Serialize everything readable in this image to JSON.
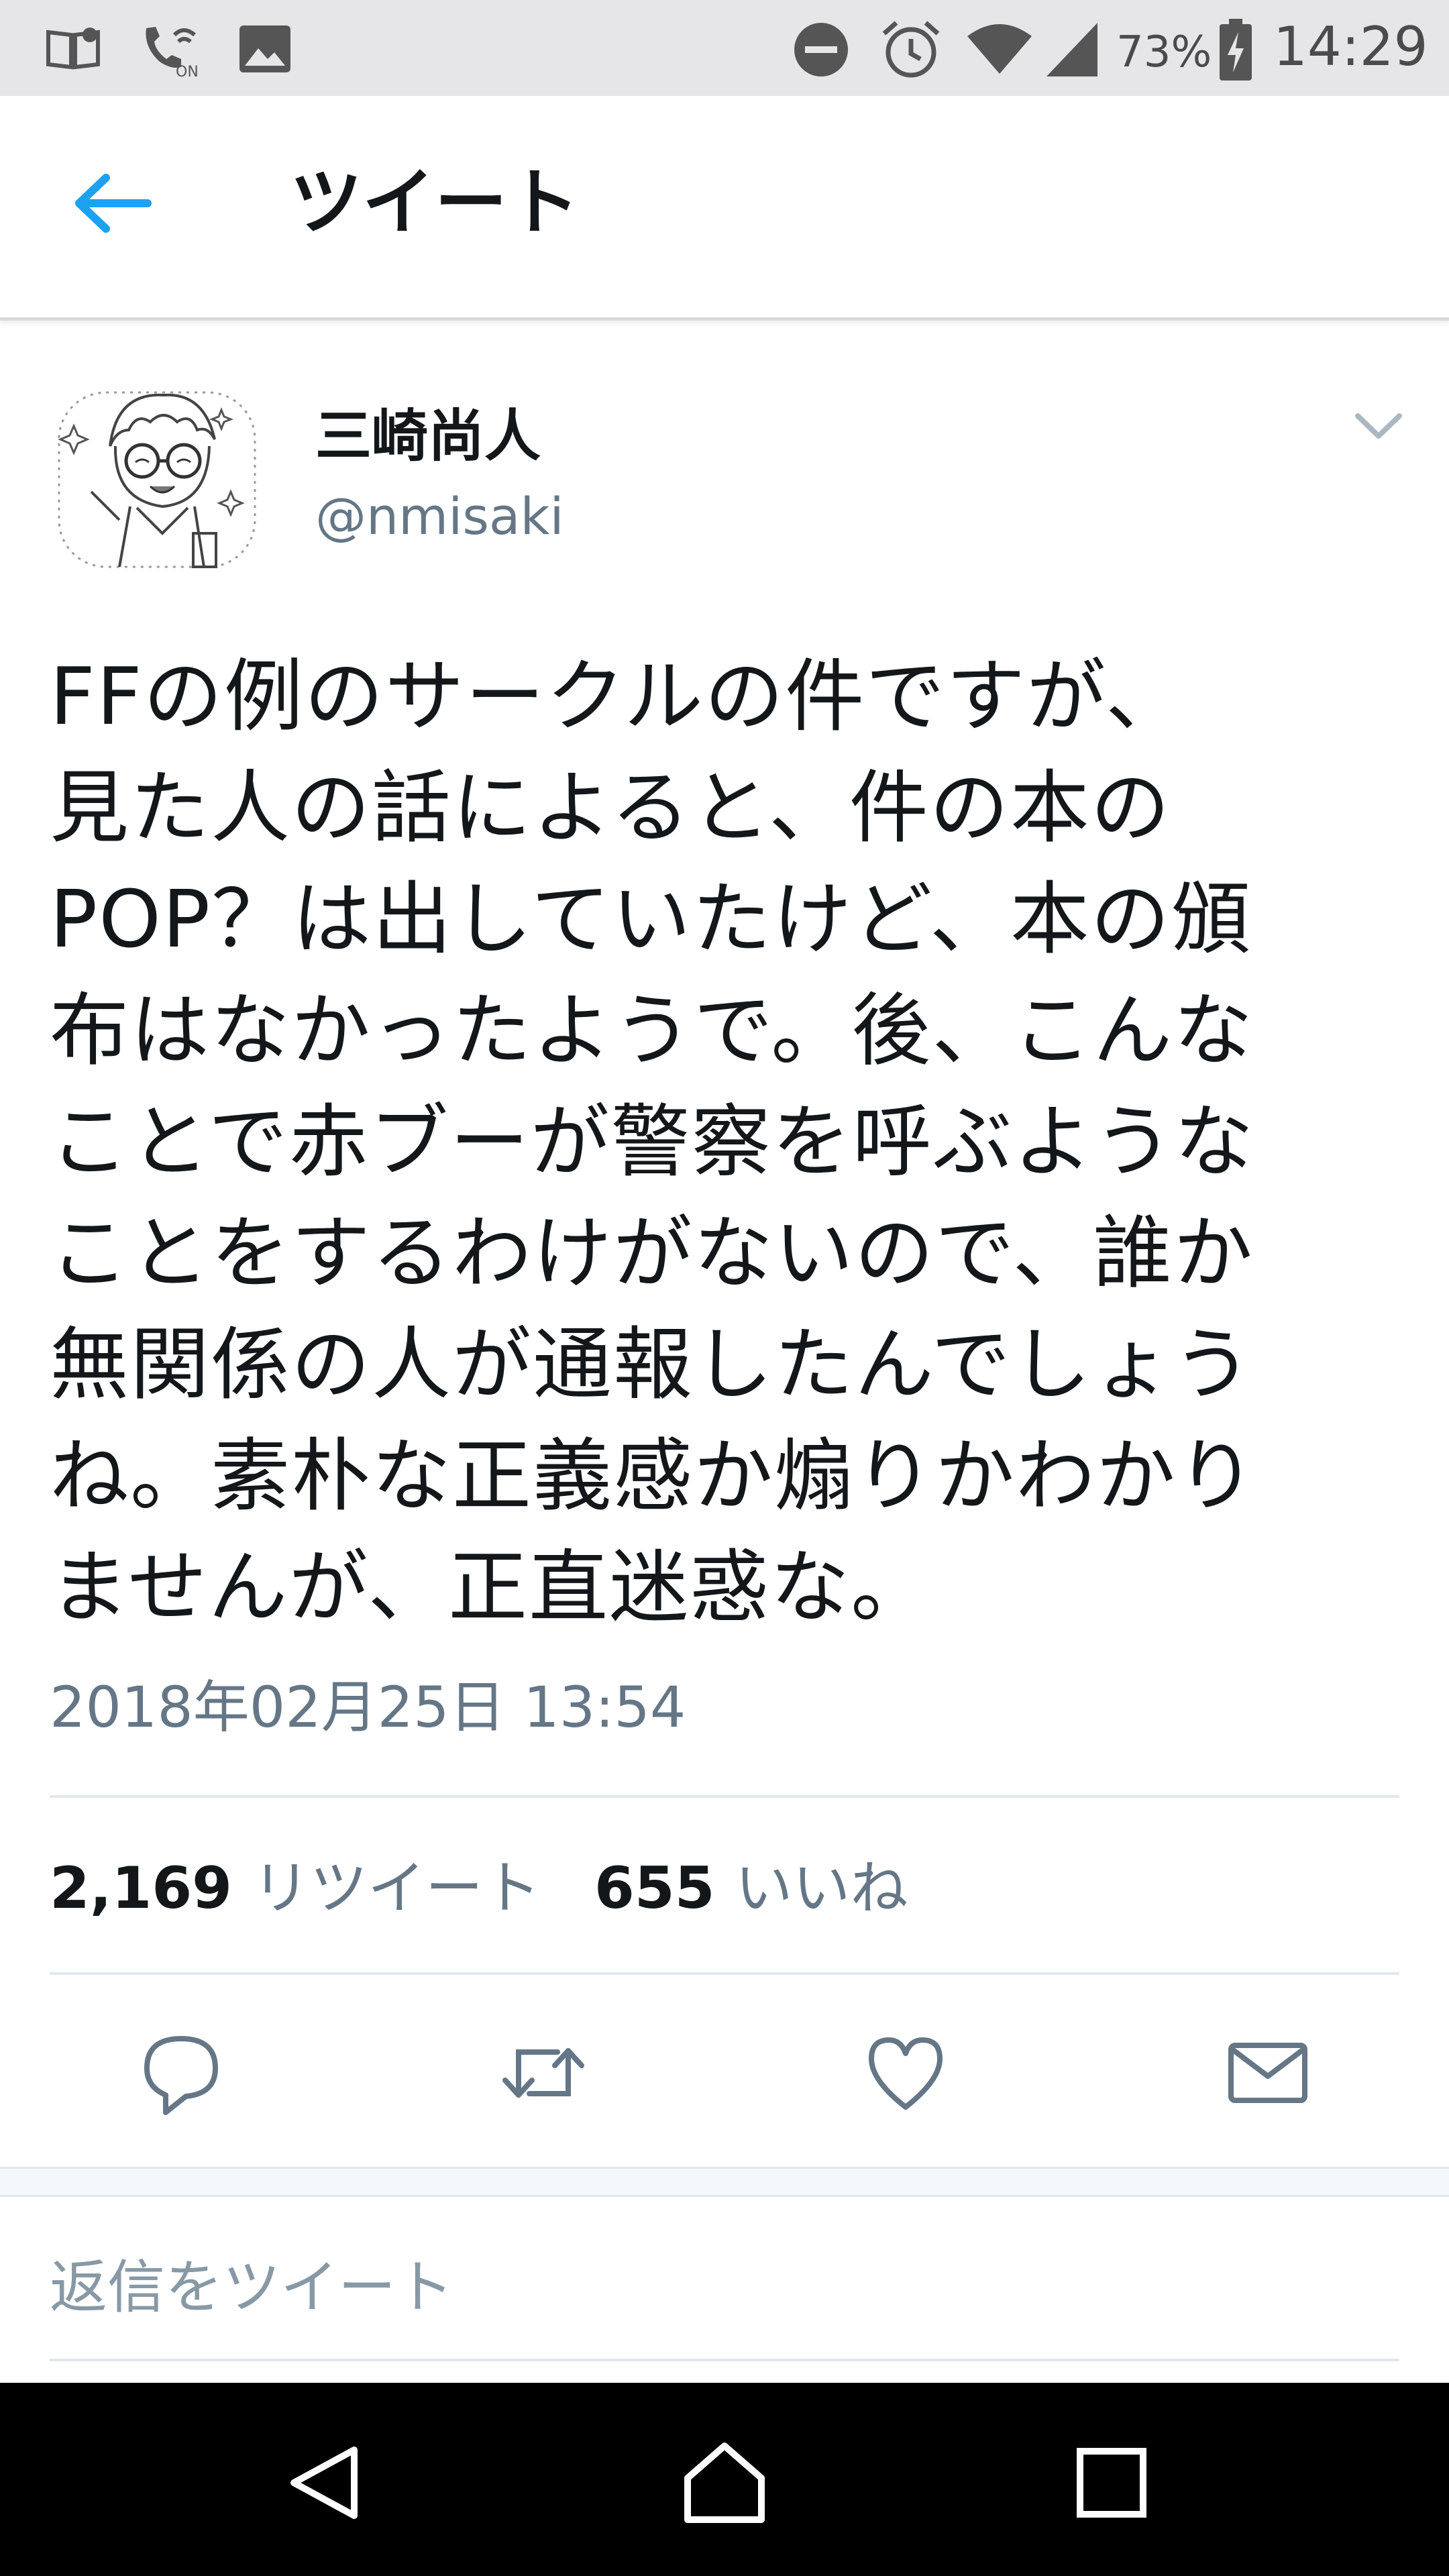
{
  "status_bar": {
    "battery_percent": "73%",
    "time": "14:29",
    "icons": [
      "book-icon",
      "wifi-calling-icon",
      "image-icon",
      "do-not-disturb-icon",
      "alarm-icon",
      "wifi-icon",
      "signal-icon",
      "battery-charging-icon"
    ]
  },
  "header": {
    "title": "ツイート",
    "back_icon": "back-arrow-icon"
  },
  "tweet": {
    "author_name": "三崎尚人",
    "author_handle": "@nmisaki",
    "text": "FFの例のサークルの件ですが、\n見た人の話によると、件の本の\nPOP？は出していたけど、本の頒\n布はなかったようで。後、こんな\nことで赤ブーが警察を呼ぶような\nことをするわけがないので、誰か\n無関係の人が通報したんでしょう\nね。素朴な正義感か煽りかわかり\nませんが、正直迷惑な。",
    "timestamp": "2018年02月25日 13:54",
    "retweet_count": "2,169",
    "retweet_label": "リツイート",
    "like_count": "655",
    "like_label": "いいね"
  },
  "actions": [
    "reply-icon",
    "retweet-icon",
    "like-icon",
    "message-icon"
  ],
  "reply_box": {
    "placeholder": "返信をツイート"
  },
  "colors": {
    "accent": "#1da1f2",
    "secondary_text": "#657786",
    "status_bar_bg": "#e6e6e8",
    "nav_bar_bg": "#000000"
  }
}
